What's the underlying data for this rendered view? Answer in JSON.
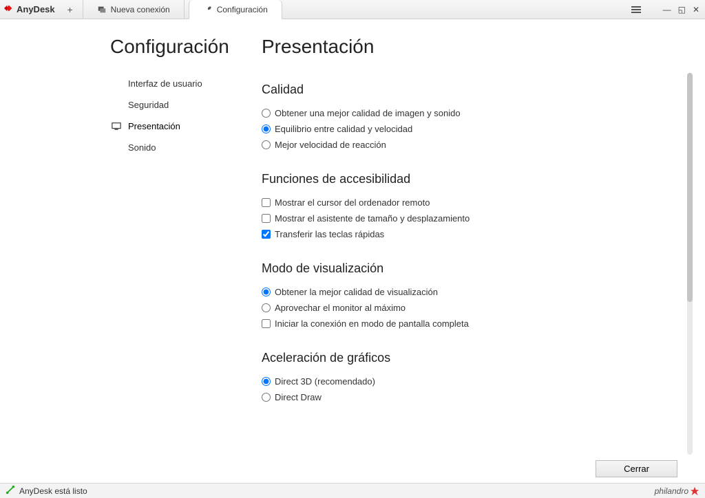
{
  "app": {
    "name": "AnyDesk"
  },
  "tabs": [
    {
      "label": "Nueva conexión"
    },
    {
      "label": "Configuración"
    }
  ],
  "sidebar": {
    "title": "Configuración",
    "items": [
      {
        "label": "Interfaz de usuario"
      },
      {
        "label": "Seguridad"
      },
      {
        "label": "Presentación"
      },
      {
        "label": "Sonido"
      }
    ]
  },
  "main": {
    "title": "Presentación",
    "sections": {
      "quality": {
        "title": "Calidad",
        "opt1": "Obtener una mejor calidad de imagen y sonido",
        "opt2": "Equilibrio entre calidad y velocidad",
        "opt3": "Mejor velocidad de reacción"
      },
      "accessibility": {
        "title": "Funciones de accesibilidad",
        "opt1": "Mostrar el cursor del ordenador remoto",
        "opt2": "Mostrar el asistente de tamaño y desplazamiento",
        "opt3": "Transferir las teclas rápidas"
      },
      "viewmode": {
        "title": "Modo de visualización",
        "opt1": "Obtener la mejor calidad de visualización",
        "opt2": "Aprovechar el monitor al máximo",
        "opt3": "Iniciar la conexión en modo de pantalla completa"
      },
      "graphics": {
        "title": "Aceleración de gráficos",
        "opt1": "Direct 3D (recomendado)",
        "opt2": "Direct Draw"
      }
    },
    "close_label": "Cerrar"
  },
  "status": {
    "text": "AnyDesk está listo",
    "brand": "philandro"
  }
}
